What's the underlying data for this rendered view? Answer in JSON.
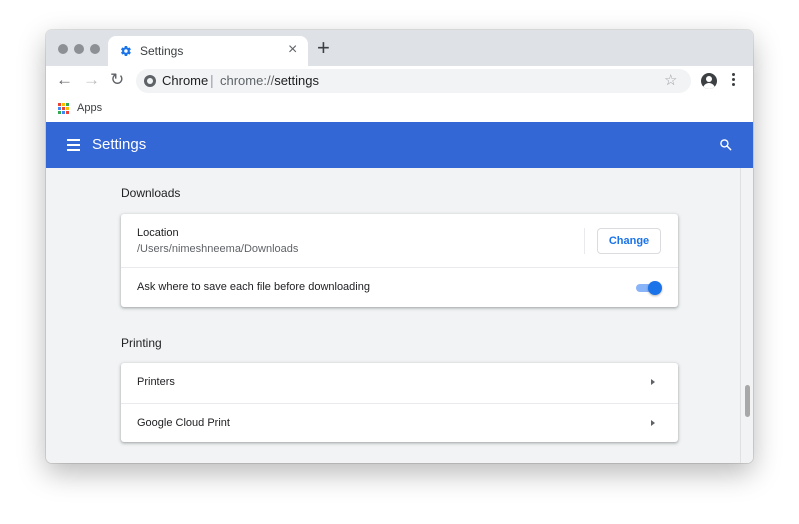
{
  "browser": {
    "tab_title": "Settings",
    "tab_close_glyph": "×",
    "new_tab_glyph": "+",
    "nav": {
      "back_glyph": "←",
      "forward_glyph": "→",
      "reload_glyph": "↻"
    },
    "omnibox": {
      "site_label": "Chrome",
      "separator": "|",
      "url_scheme": "chrome://",
      "url_host": "settings",
      "star_glyph": "☆"
    },
    "bookmarks": {
      "apps_label": "Apps"
    },
    "colors": {
      "traffic_light": "#8d9196",
      "tab_strip": "#dee1e6"
    }
  },
  "header": {
    "title": "Settings",
    "color": "#3367d6"
  },
  "downloads": {
    "section_title": "Downloads",
    "location_label": "Location",
    "location_path": "/Users/nimeshneema/Downloads",
    "change_button": "Change",
    "ask_label": "Ask where to save each file before downloading",
    "ask_enabled": true
  },
  "printing": {
    "section_title": "Printing",
    "items": [
      {
        "label": "Printers"
      },
      {
        "label": "Google Cloud Print"
      }
    ]
  },
  "icons": {
    "tab_favicon": "gear-icon",
    "menu": "hamburger-icon",
    "search": "search-icon",
    "profile": "account-circle-icon",
    "more": "more-vert-icon",
    "row_arrow": "arrow-right-icon"
  },
  "accent_color": "#1a73e8"
}
